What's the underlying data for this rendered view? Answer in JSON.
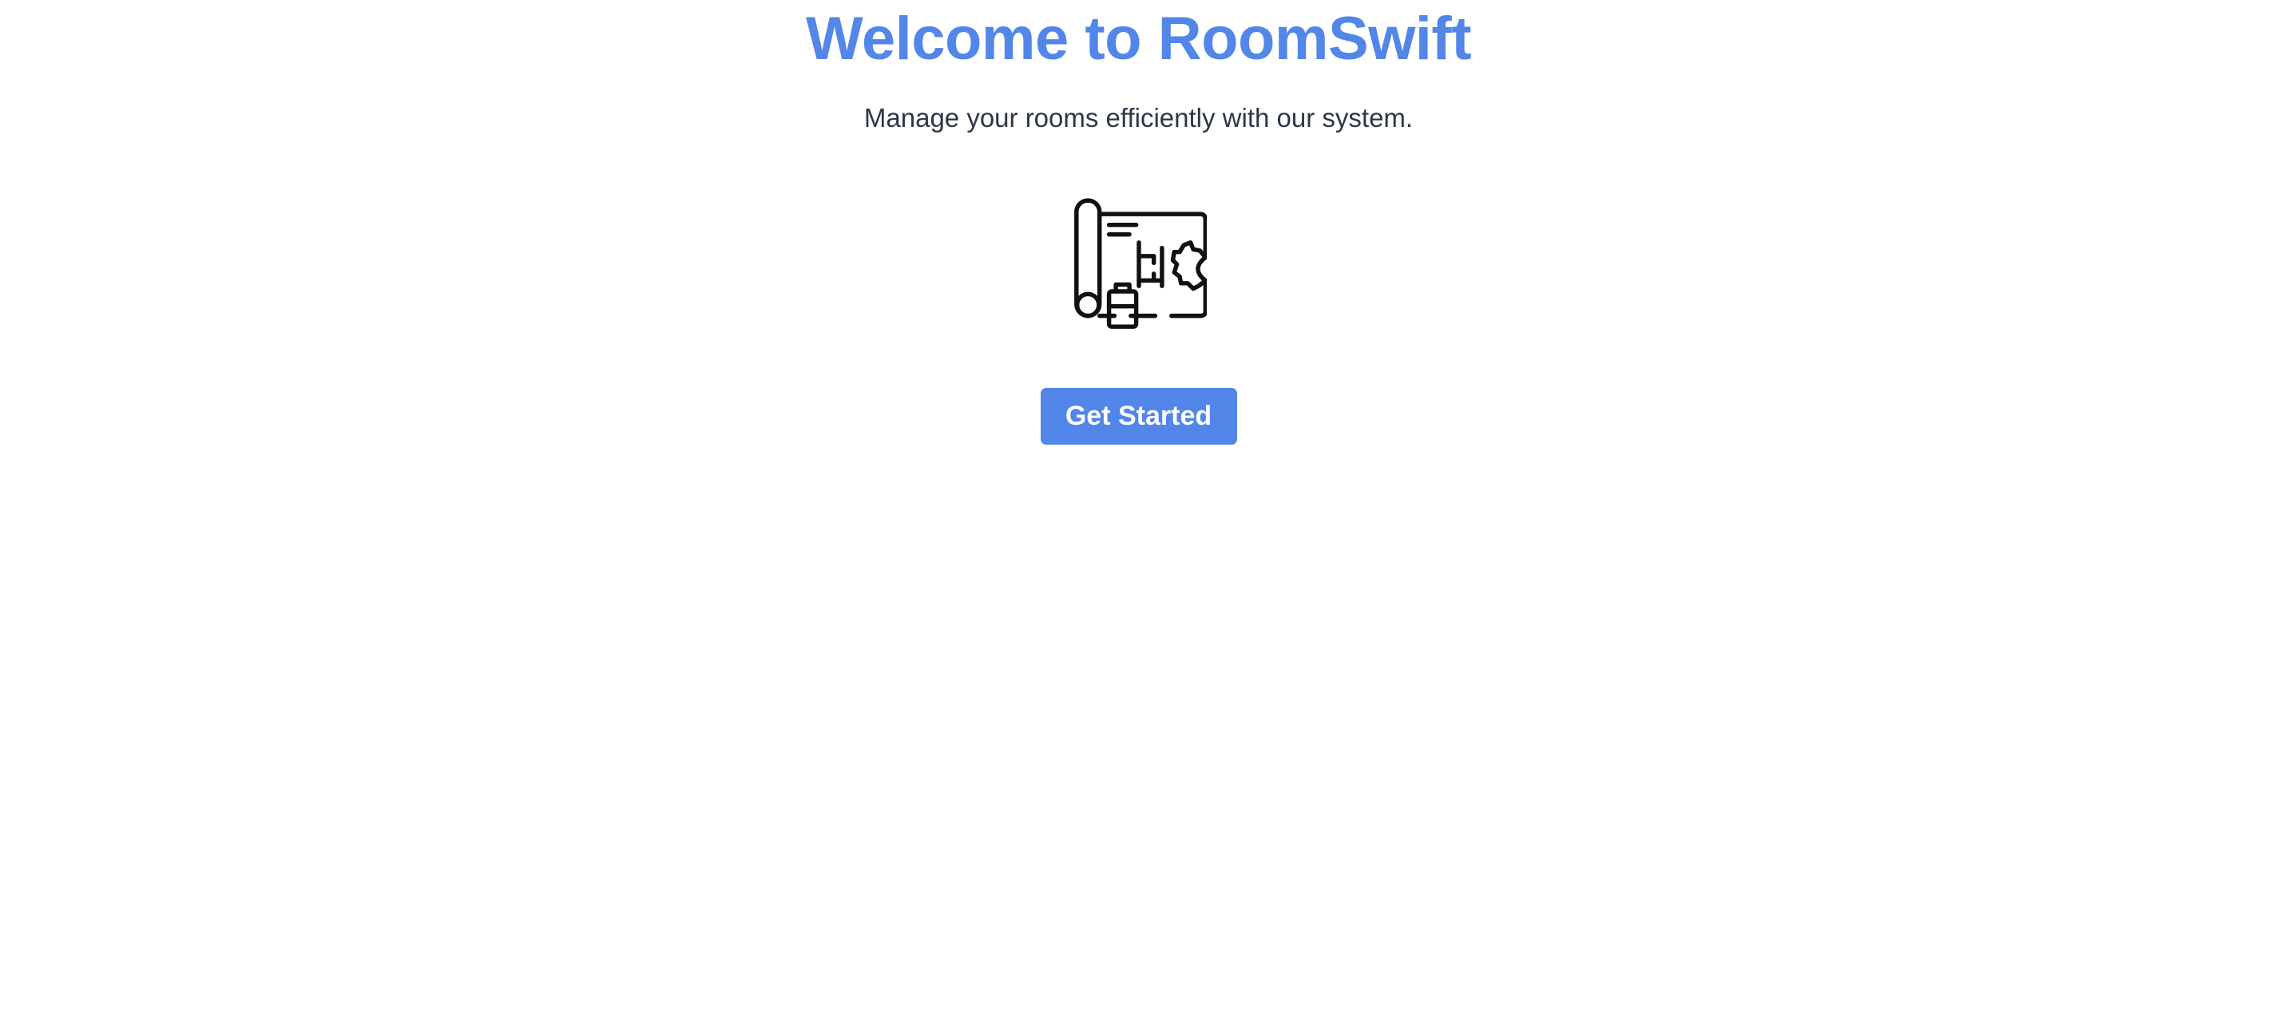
{
  "hero": {
    "title": "Welcome to RoomSwift",
    "subtitle": "Manage your rooms efficiently with our system.",
    "icon": "blueprint-icon",
    "cta_label": "Get Started"
  },
  "theme": {
    "accent": "#5286e8",
    "text": "#2d3748",
    "icon_stroke": "#111111",
    "background": "#ffffff"
  }
}
